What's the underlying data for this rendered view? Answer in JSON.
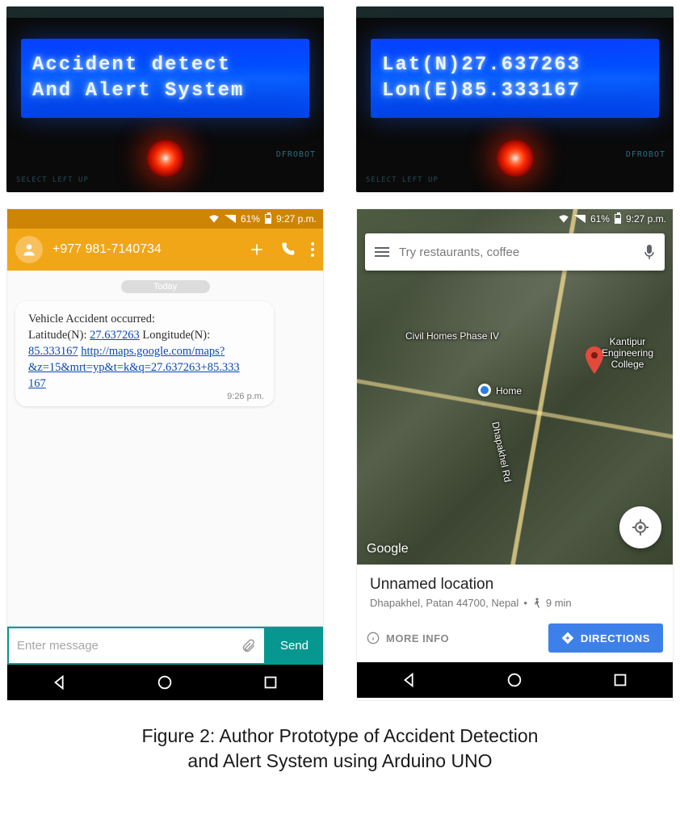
{
  "lcd": {
    "left_line1": "Accident detect",
    "left_line2": "And Alert System",
    "right_line1": "Lat(N)27.637263",
    "right_line2": "Lon(E)85.333167",
    "pcb_brand": "DFROBOT",
    "pcb_buttons": "SELECT LEFT UP"
  },
  "status": {
    "battery_pct": "61%",
    "time": "9:27 p.m."
  },
  "sms": {
    "phone_number": "+977 981-7140734",
    "day_label": "Today",
    "msg_line1": "Vehicle Accident occurred:",
    "msg_line2a": "Latitude(N): ",
    "msg_lat": "27.637263",
    "msg_line2b": " Longitude(N): ",
    "msg_lon": "85.333167",
    "msg_url1": "http://maps.google.com/maps?",
    "msg_url2": "&z=15&mrt=yp&t=k&q=27.637263+85.333",
    "msg_url3": "167",
    "msg_time": "9:26 p.m.",
    "composer_placeholder": "Enter message",
    "send_label": "Send"
  },
  "map": {
    "search_placeholder": "Try restaurants, coffee",
    "poi_civil": "Civil Homes Phase IV",
    "poi_college1": "Kantipur",
    "poi_college2": "Engineering",
    "poi_college3": "College",
    "poi_home": "Home",
    "poi_road": "Dhapakhel Rd",
    "google_label": "Google",
    "loc_title": "Unnamed location",
    "loc_sub": "Dhapakhel, Patan 44700, Nepal",
    "walk_time": "9 min",
    "more_info": "MORE INFO",
    "directions": "DIRECTIONS"
  },
  "caption": {
    "line1": "Figure 2: Author Prototype of Accident Detection",
    "line2": "and Alert System using Arduino UNO"
  }
}
